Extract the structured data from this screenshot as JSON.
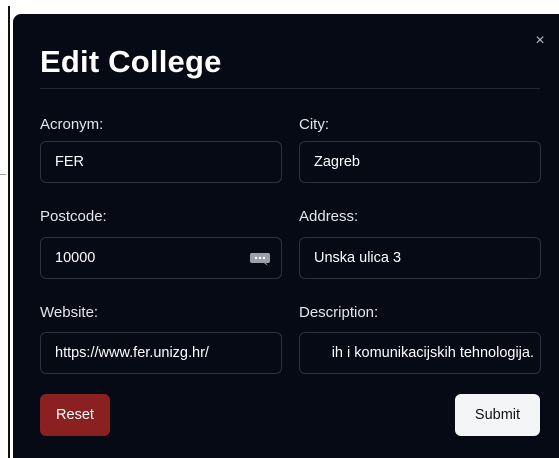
{
  "dialog": {
    "title": "Edit College",
    "close_symbol": "×"
  },
  "fields": {
    "acronym": {
      "label": "Acronym:",
      "value": "FER"
    },
    "city": {
      "label": "City:",
      "value": "Zagreb"
    },
    "postcode": {
      "label": "Postcode:",
      "value": "10000",
      "icon": "speech-bubble-ellipsis-icon"
    },
    "address": {
      "label": "Address:",
      "value": "Unska ulica 3"
    },
    "website": {
      "label": "Website:",
      "value": "https://www.fer.unizg.hr/"
    },
    "description": {
      "label": "Description:",
      "value": "ih i komunikacijskih tehnologija."
    }
  },
  "buttons": {
    "reset_label": "Reset",
    "submit_label": "Submit"
  },
  "colors": {
    "modal_background": "#060a14",
    "reset_button": "#8b2020",
    "submit_button": "#f4f5f7",
    "field_border": "#2a3140"
  }
}
